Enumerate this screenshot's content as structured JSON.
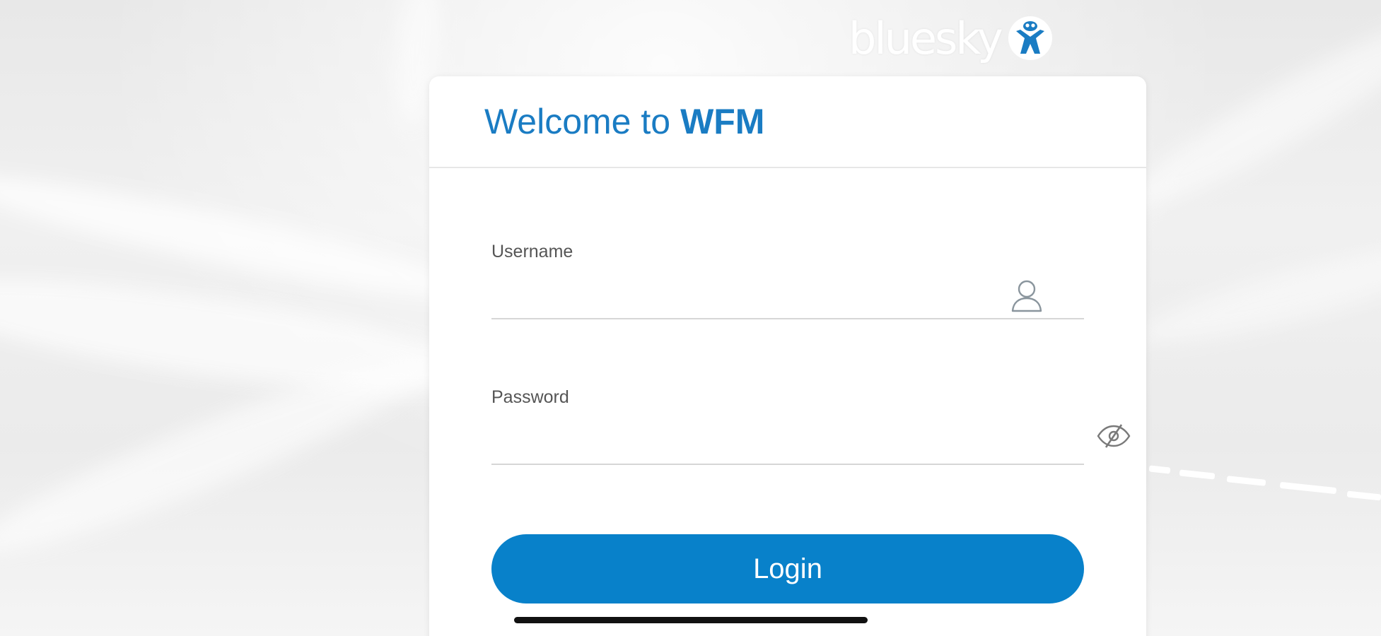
{
  "brand": {
    "logo_text": "bluesky",
    "logo_icon": "bluesky-mascot-icon"
  },
  "welcome": {
    "prefix": "Welcome to",
    "app_name": "WFM"
  },
  "form": {
    "username": {
      "label": "Username",
      "value": "",
      "icon": "user-icon"
    },
    "password": {
      "label": "Password",
      "value": "",
      "icon": "eye-slash-icon"
    },
    "login_label": "Login"
  },
  "colors": {
    "accent": "#0881ca",
    "title": "#1a7cc3"
  }
}
